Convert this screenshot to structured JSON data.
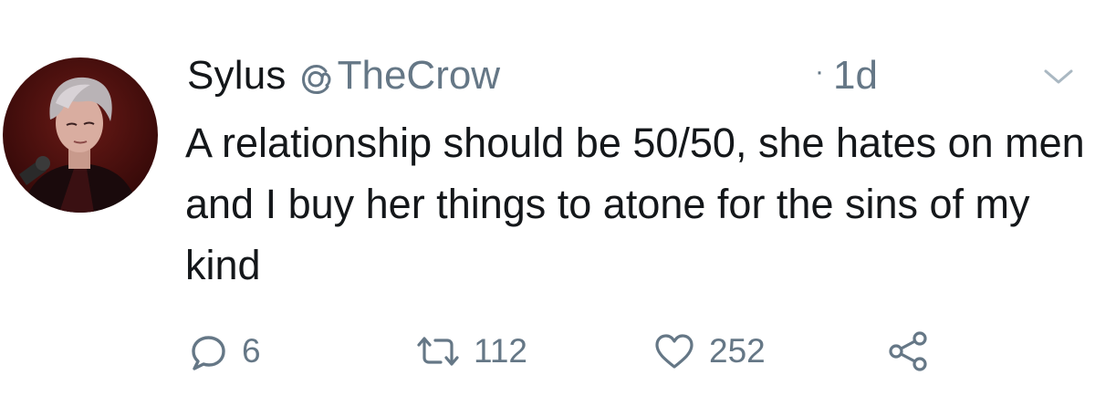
{
  "tweet": {
    "display_name": "Sylus",
    "handle": "TheCrow",
    "handle_icon": "threads-at-icon",
    "timestamp": "1d",
    "timestamp_separator": "·",
    "text": "A relationship should be 50/50, she hates on men and I buy her things to atone for the sins of my kind",
    "actions": {
      "reply": {
        "icon": "reply-icon",
        "count": "6"
      },
      "retweet": {
        "icon": "retweet-icon",
        "count": "112"
      },
      "like": {
        "icon": "heart-icon",
        "count": "252"
      },
      "share": {
        "icon": "share-icon"
      }
    },
    "menu_icon": "chevron-down-icon"
  },
  "colors": {
    "primary_text": "#14171a",
    "secondary_text": "#657786",
    "background": "#ffffff",
    "avatar_background": "#4a0f0f"
  }
}
